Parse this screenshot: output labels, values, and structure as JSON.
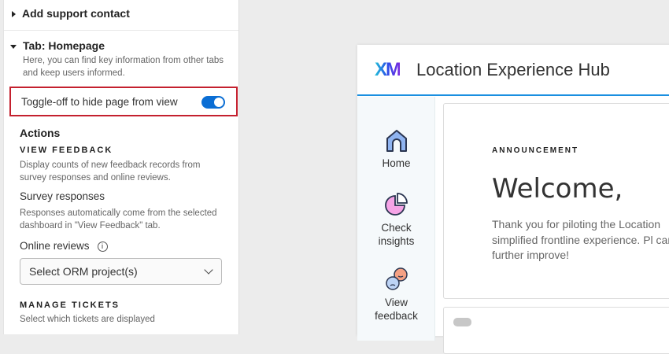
{
  "panel": {
    "support_contact": "Add support contact",
    "tab_homepage": "Tab: Homepage",
    "tab_desc": "Here, you can find key information from other tabs and keep users informed.",
    "toggle_label": "Toggle-off to hide page from view",
    "toggle_on": true,
    "actions": "Actions",
    "view_feedback": "VIEW FEEDBACK",
    "view_feedback_desc": "Display counts of new feedback records from survey responses and online reviews.",
    "survey_responses": "Survey responses",
    "survey_desc": "Responses automatically come from the selected dashboard in \"View Feedback\" tab.",
    "online_reviews": "Online reviews",
    "orm_select": "Select ORM project(s)",
    "manage_tickets": "MANAGE TICKETS",
    "manage_desc": "Select which tickets are displayed"
  },
  "preview": {
    "logo": "XM",
    "title": "Location Experience Hub",
    "nav": [
      {
        "label": "Home"
      },
      {
        "label": "Check insights"
      },
      {
        "label": "View feedback"
      }
    ],
    "announcement_label": "ANNOUNCEMENT",
    "welcome": "Welcome,",
    "body": "Thank you for piloting the Location simplified frontline experience. Pl can further improve!"
  }
}
